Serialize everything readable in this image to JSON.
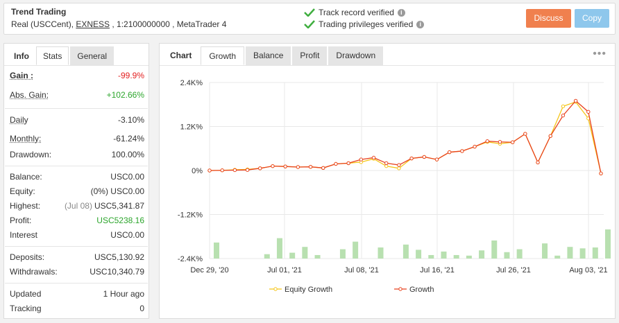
{
  "header": {
    "title": "Trend Trading",
    "account_prefix": "Real (USCCent), ",
    "broker": "EXNESS",
    "account_suffix": " , 1:2100000000 , MetaTrader 4",
    "verify_1": "Track record verified",
    "verify_2": "Trading privileges verified",
    "discuss_label": "Discuss",
    "copy_label": "Copy"
  },
  "left_tabs": [
    "Info",
    "Stats",
    "General"
  ],
  "stats": {
    "gain_label": "Gain :",
    "gain_value": "-99.9%",
    "abs_gain_label": "Abs. Gain:",
    "abs_gain_value": "+102.66%",
    "daily_label": "Daily",
    "daily_value": "-3.10%",
    "monthly_label": "Monthly:",
    "monthly_value": "-61.24%",
    "drawdown_label": "Drawdown:",
    "drawdown_value": "100.00%",
    "balance_label": "Balance:",
    "balance_value": "USC0.00",
    "equity_label": "Equity:",
    "equity_pct": "(0%)",
    "equity_value": "USC0.00",
    "highest_label": "Highest:",
    "highest_date": "(Jul 08)",
    "highest_value": "USC5,341.87",
    "profit_label": "Profit:",
    "profit_value": "USC5238.16",
    "interest_label": "Interest",
    "interest_value": "USC0.00",
    "deposits_label": "Deposits:",
    "deposits_value": "USC5,130.92",
    "withdrawals_label": "Withdrawals:",
    "withdrawals_value": "USC10,340.79",
    "updated_label": "Updated",
    "updated_value": "1 Hour ago",
    "tracking_label": "Tracking",
    "tracking_value": "0"
  },
  "right_tabs": [
    "Chart",
    "Growth",
    "Balance",
    "Profit",
    "Drawdown"
  ],
  "more_icon": "•••",
  "colors": {
    "equity": "#f5c518",
    "growth": "#e8421e",
    "bars": "#b8e0b0",
    "discuss": "#f0804e",
    "copy": "#8ec7ec"
  },
  "chart_data": {
    "type": "line",
    "y_ticks": [
      "2.4K%",
      "1.2K%",
      "0%",
      "-1.2K%",
      "-2.4K%"
    ],
    "y_values": [
      2400,
      1200,
      0,
      -1200,
      -2400
    ],
    "x_ticks": [
      "Dec 29, '20",
      "Jul 01, '21",
      "Jul 08, '21",
      "Jul 16, '21",
      "Jul 26, '21",
      "Aug 03, '21"
    ],
    "ylim": [
      -2400,
      2400
    ],
    "legend": [
      "Equity Growth",
      "Growth"
    ],
    "series": [
      {
        "name": "Growth",
        "values": [
          0,
          5,
          10,
          15,
          60,
          120,
          110,
          95,
          100,
          70,
          180,
          200,
          300,
          350,
          200,
          150,
          330,
          370,
          300,
          500,
          530,
          650,
          800,
          780,
          770,
          1000,
          220,
          940,
          1500,
          1900,
          1600,
          -80
        ]
      },
      {
        "name": "Equity Growth",
        "values": [
          0,
          5,
          20,
          30,
          60,
          120,
          110,
          95,
          100,
          70,
          180,
          200,
          230,
          320,
          120,
          60,
          330,
          370,
          300,
          500,
          530,
          650,
          780,
          730,
          770,
          1000,
          220,
          940,
          1750,
          1870,
          1420,
          -80
        ]
      }
    ],
    "bars": [
      0.55,
      0,
      0,
      0,
      0.15,
      0.7,
      0.2,
      0.4,
      0.12,
      0,
      0.32,
      0.58,
      0,
      0.38,
      0,
      0.48,
      0.3,
      0.12,
      0.24,
      0.12,
      0.1,
      0.28,
      0.62,
      0.22,
      0.32,
      0,
      0.52,
      0.1,
      0.4,
      0.35,
      0.38,
      1.0
    ]
  }
}
